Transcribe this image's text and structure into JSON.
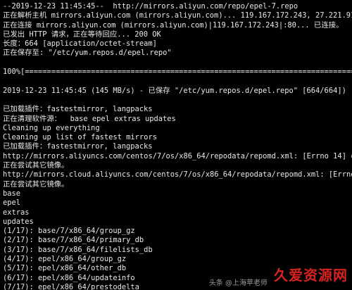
{
  "terminal": {
    "lines": [
      "--2019-12-23 11:45:45--  http://mirrors.aliyun.com/repo/epel-7.repo",
      "正在解析主机 mirrors.aliyun.com (mirrors.aliyun.com)... 119.167.172.243, 27.221.91",
      "正在连接 mirrors.aliyun.com (mirrors.aliyun.com)|119.167.172.243|:80... 已连接。",
      "已发出 HTTP 请求，正在等待回应... 200 OK",
      "长度：664 [application/octet-stream]",
      "正在保存至: \"/etc/yum.repos.d/epel.repo\"",
      "",
      "100%[=================================================================================",
      "",
      "2019-12-23 11:45:45 (145 MB/s) - 已保存 \"/etc/yum.repos.d/epel.repo\" [664/664])",
      "",
      "已加载插件：fastestmirror, langpacks",
      "正在清理软件源：  base epel extras updates",
      "Cleaning up everything",
      "Cleaning up list of fastest mirrors",
      "已加载插件：fastestmirror, langpacks",
      "http://mirrors.aliyuncs.com/centos/7/os/x86_64/repodata/repomd.xml: [Errno 14] cu",
      "正在尝试其它镜像。",
      "http://mirrors.cloud.aliyuncs.com/centos/7/os/x86_64/repodata/repomd.xml: [Errno 1",
      "正在尝试其它镜像。",
      "base",
      "epel",
      "extras",
      "updates",
      "(1/17): base/7/x86_64/group_gz",
      "(2/17): base/7/x86_64/primary_db",
      "(3/17): base/7/x86_64/filelists_db",
      "(4/17): epel/x86_64/group_gz",
      "(5/17): epel/x86_64/other_db",
      "(6/17): epel/x86_64/updateinfo",
      "(7/17): epel/x86_64/prestodelta"
    ]
  },
  "watermark": {
    "logo": "久爱资源网",
    "sub": "头条 @上海苹老师"
  },
  "colors": {
    "background": "#000000",
    "text": "#e8e8e8",
    "watermark": "#d9231e"
  }
}
